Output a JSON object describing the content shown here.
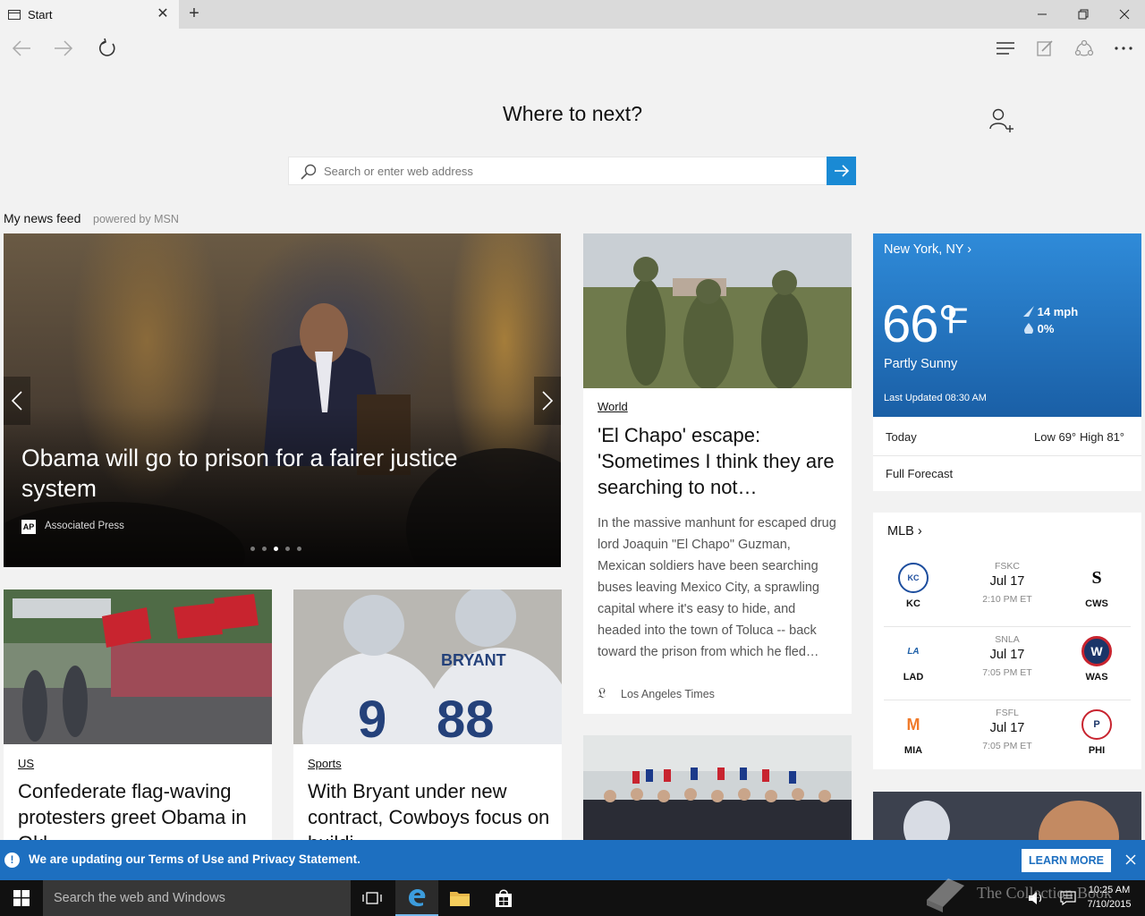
{
  "browser": {
    "tab_title": "Start",
    "new_tab_glyph": "+",
    "close_tab_glyph": "✕"
  },
  "start": {
    "heading": "Where to next?",
    "search_placeholder": "Search or enter web address"
  },
  "feed": {
    "title": "My news feed",
    "powered_by": "powered by MSN"
  },
  "hero": {
    "title": "Obama will go to prison for a fairer justice system",
    "source_logo": "AP",
    "source": "Associated Press",
    "dots_count": 5,
    "active_dot": 3
  },
  "articles": [
    {
      "category": "World",
      "title": "'El Chapo' escape: 'Sometimes I think they are searching to not…",
      "body": "In the massive manhunt for escaped drug lord Joaquin \"El Chapo\" Guzman, Mexican soldiers have been searching buses leaving Mexico City, a sprawling capital where it's easy to hide, and headed into the town of Toluca -- back toward the prison from which he fled…",
      "source": "Los Angeles Times"
    },
    {
      "category": "US",
      "title": "Confederate flag-waving protesters greet Obama in Okl…"
    },
    {
      "category": "Sports",
      "title": "With Bryant under new contract, Cowboys focus on buildi…"
    }
  ],
  "weather": {
    "city": "New York, NY",
    "temp": "66°",
    "unit": "F",
    "condition": "Partly Sunny",
    "wind": "14 mph",
    "precip": "0%",
    "updated": "Last Updated 08:30 AM",
    "today_label": "Today",
    "low": "Low 69°",
    "high": "High 81°",
    "forecast_link": "Full Forecast"
  },
  "mlb": {
    "title": "MLB",
    "games": [
      {
        "away": "KC",
        "home": "CWS",
        "network": "FSKC",
        "date": "Jul 17",
        "time": "2:10 PM ET"
      },
      {
        "away": "LAD",
        "home": "WAS",
        "network": "SNLA",
        "date": "Jul 17",
        "time": "7:05 PM ET"
      },
      {
        "away": "MIA",
        "home": "PHI",
        "network": "FSFL",
        "date": "Jul 17",
        "time": "7:05 PM ET"
      }
    ]
  },
  "banner": {
    "text": "We are updating our Terms of Use and Privacy Statement.",
    "button": "LEARN MORE"
  },
  "taskbar": {
    "search_text": "Search the web and Windows",
    "time": "10:25 AM",
    "date": "7/10/2015",
    "watermark": "The Collection Book"
  },
  "colors": {
    "accent": "#1a8ad4",
    "banner": "#1d6fc0",
    "taskbar": "#111111"
  }
}
